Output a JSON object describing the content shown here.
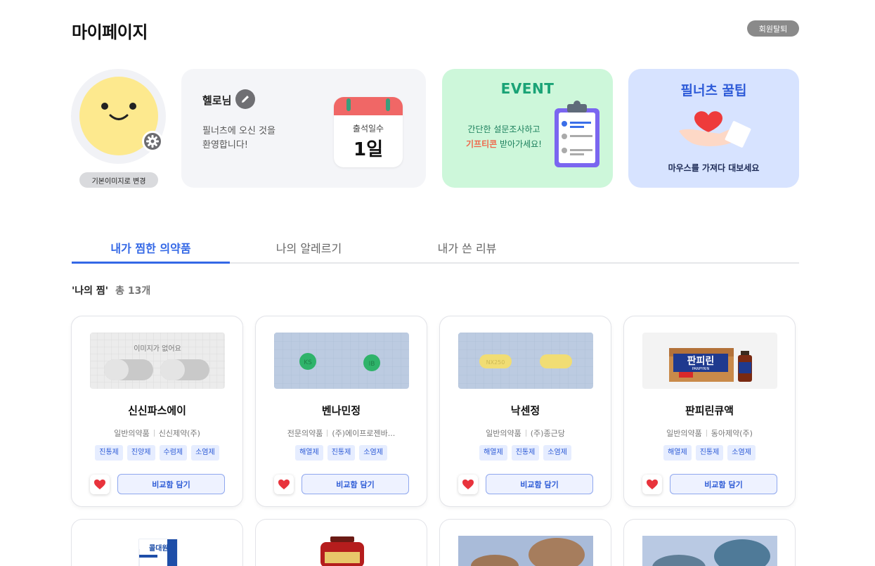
{
  "header": {
    "title": "마이페이지",
    "withdraw_label": "회원탈퇴"
  },
  "profile": {
    "reset_image_label": "기본이미지로 변경",
    "greeting_name": "헬로님",
    "greeting_line1": "필너츠에 오신 것을",
    "greeting_line2": "환영합니다!",
    "attendance_label": "출석일수",
    "attendance_value": "1일"
  },
  "event": {
    "title": "EVENT",
    "line1": "간단한 설문조사하고",
    "highlight": "기프티콘",
    "line2_rest": " 받아가세요!"
  },
  "tips": {
    "title": "필너츠 꿀팁",
    "hint": "마우스를 가져다 대보세요"
  },
  "tabs": [
    "내가 찜한 의약품",
    "나의 알레르기",
    "내가 쓴 리뷰"
  ],
  "list": {
    "title": "'나의 찜'",
    "count": "총 13개"
  },
  "common": {
    "compare_label": "비교함 담기",
    "no_image_text": "이미지가 없어요"
  },
  "cards": [
    {
      "name": "신신파스에이",
      "category": "일반의약품",
      "maker": "신신제약(주)",
      "tags": [
        "진통제",
        "진양제",
        "수렴제",
        "소염제"
      ]
    },
    {
      "name": "벤나민정",
      "category": "전문의약품",
      "maker": "(주)에이프로젠바...",
      "tags": [
        "해열제",
        "진통제",
        "소염제"
      ]
    },
    {
      "name": "낙센정",
      "category": "일반의약품",
      "maker": "(주)종근당",
      "tags": [
        "해열제",
        "진통제",
        "소염제"
      ]
    },
    {
      "name": "판피린큐액",
      "category": "일반의약품",
      "maker": "동아제약(주)",
      "tags": [
        "해열제",
        "진통제",
        "소염제"
      ]
    }
  ],
  "pill_marks": {
    "card2_left": "KS",
    "card2_right": "IB",
    "card3_left": "NX250"
  },
  "product_labels": {
    "panpyrin": "판피린",
    "panpyrin_en": "PANPYRIN",
    "second_row_box": "콜대원"
  },
  "colors": {
    "accent": "#3468e6",
    "event_bg": "#cdf7da",
    "tip_bg": "#d7e3ff",
    "heart": "#e8333c"
  }
}
